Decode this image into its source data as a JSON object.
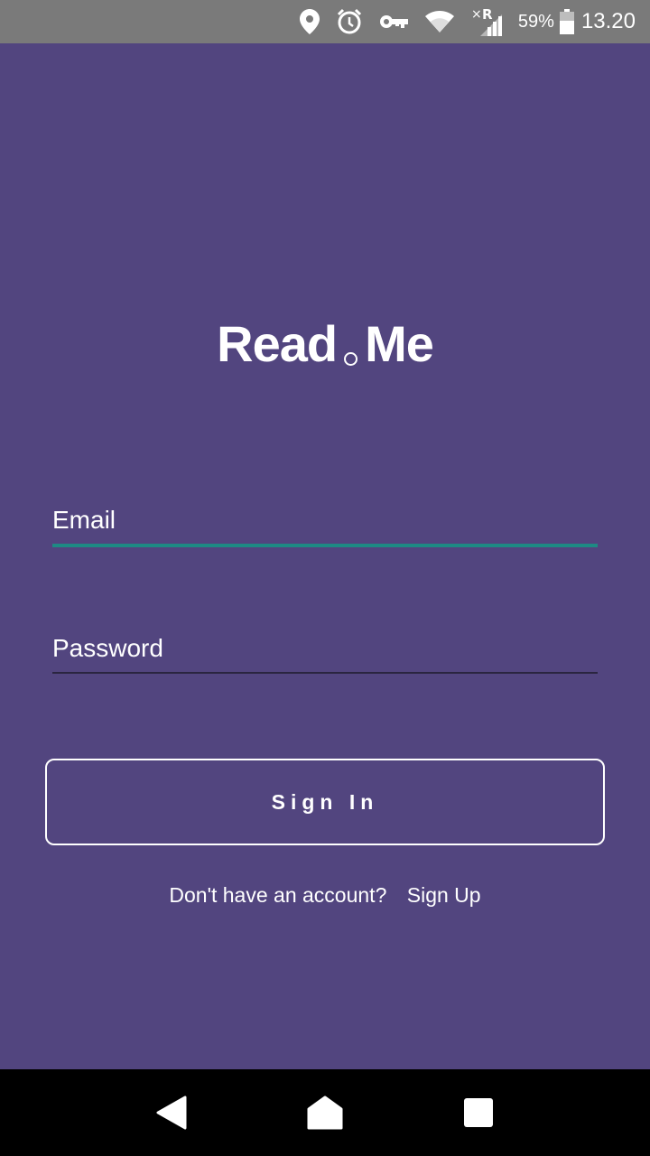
{
  "status_bar": {
    "battery_percent": "59%",
    "time": "13.20",
    "icons": [
      "location-icon",
      "alarm-icon",
      "vpn-key-icon",
      "wifi-icon",
      "signal-roaming-icon",
      "battery-icon"
    ],
    "roaming_mark": "R",
    "no_data_mark": "×"
  },
  "app": {
    "logo": {
      "left": "Read",
      "right": "Me"
    },
    "email": {
      "label": "Email"
    },
    "password": {
      "label": "Password"
    },
    "sign_in_label": "Sign In",
    "signup_prompt": "Don't have an account?",
    "signup_link": "Sign Up",
    "colors": {
      "background": "#52457f",
      "focus_underline": "#1e8a84",
      "status_bar": "#7a7a7a",
      "nav_bar": "#000000"
    }
  },
  "nav_bar": {
    "icons": [
      "back-icon",
      "home-icon",
      "recents-icon"
    ]
  }
}
